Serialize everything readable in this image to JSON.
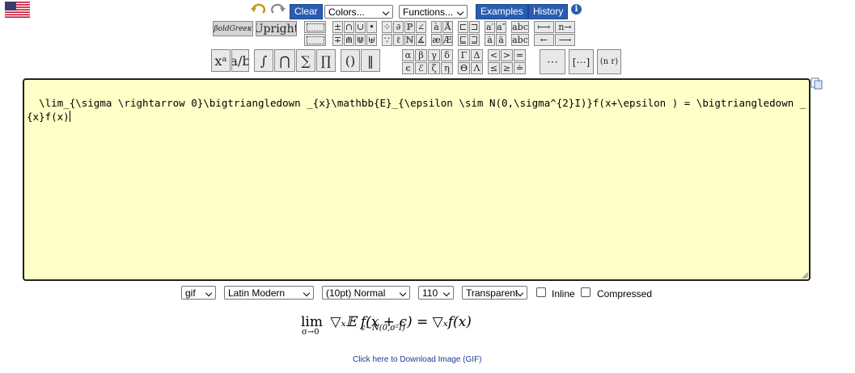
{
  "toolbar": {
    "clear_label": "Clear",
    "colors_label": "Colors...",
    "functions_label": "Functions...",
    "examples_label": "Examples",
    "history_label": "History",
    "info_icon": "i"
  },
  "symbols": {
    "bold_green": "βoldGreeκ",
    "upright": "Upright",
    "row1": [
      "±",
      "∩",
      "∪",
      "•",
      "⁘",
      "∂",
      "ℙ",
      "∠",
      "à",
      "Å",
      "⊏",
      "⊐",
      "a′",
      "a″",
      "abc",
      "⟼",
      "n→"
    ],
    "row2": [
      "∓",
      "⋒",
      "⋓",
      "⊎",
      "∵",
      "ℓ",
      "ℕ",
      "∡",
      "æ",
      "Æ",
      "⊑",
      "⊒",
      "ȧ",
      "ä",
      "abc",
      "←",
      "⟶"
    ],
    "big": [
      "xᵃ",
      "a/b",
      "∫",
      "⋂",
      "∑",
      "∏",
      "()",
      "‖"
    ],
    "greek_row1": [
      "α",
      "β",
      "γ",
      "δ",
      "Γ",
      "Δ",
      "<",
      ">",
      "="
    ],
    "greek_row2": [
      "ϵ",
      "ℰ",
      "ζ",
      "η",
      "Θ",
      "Λ",
      "≤",
      "≥",
      "≐"
    ],
    "matrix": "⋯",
    "brackets": "[⋯]",
    "binom": "(n r)"
  },
  "editor": {
    "content": "\\lim_{\\sigma \\rightarrow 0}\\bigtriangledown _{x}\\mathbb{E}_{\\epsilon \\sim N(0,\\sigma^{2}I)}f(x+\\epsilon ) = \\bigtriangledown _{x}f(x)"
  },
  "options": {
    "format": "gif",
    "font": "Latin Modern",
    "size": "(10pt) Normal",
    "dpi": "110",
    "background": "Transparent",
    "inline_label": "Inline",
    "compressed_label": "Compressed"
  },
  "preview": {
    "lim": "lim",
    "sub": "σ→0",
    "rest": "▽ₓ𝔼 f(x + ϵ) = ▽ₓf(x)",
    "sub_e": "ϵ∼N(0,σ²I)"
  },
  "download": {
    "label": "Click here to Download Image (GIF)"
  },
  "colors": {
    "accent": "#2a5db0",
    "editor_bg": "#ffffc8",
    "link": "#1a3d9c"
  }
}
